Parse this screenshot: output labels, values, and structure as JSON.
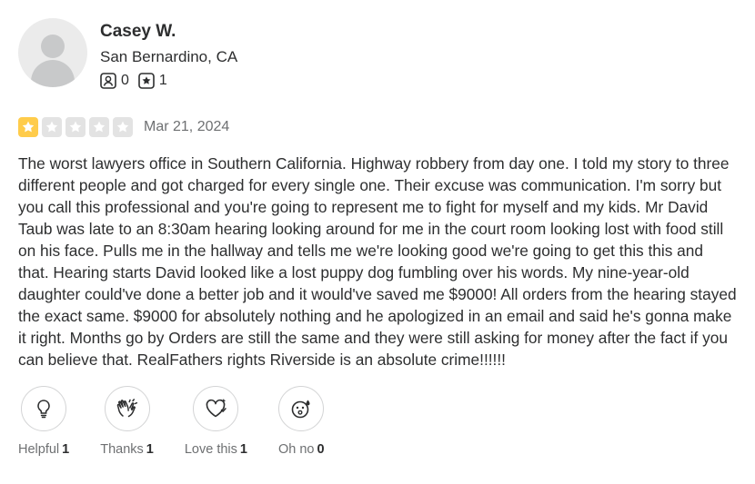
{
  "user": {
    "name": "Casey W.",
    "location": "San Bernardino, CA",
    "friends_count": "0",
    "reviews_count": "1"
  },
  "review": {
    "rating": 1,
    "max_rating": 5,
    "date": "Mar 21, 2024",
    "text": "The worst lawyers office in Southern California. Highway robbery from day one. I told my story to three different people and got charged for every single one. Their excuse was communication. I'm sorry but you call this professional and you're going to represent me to fight for myself and my kids. Mr David Taub was late to an 8:30am hearing looking around for me in the court room looking lost with food still on his face. Pulls me in the hallway and tells me we're looking good we're going to get this this and that. Hearing starts David looked like a lost puppy dog fumbling over his words. My nine-year-old daughter could've done a better job and it would've saved me $9000! All orders from the hearing stayed the exact same. $9000 for absolutely nothing and he apologized in an email and said he's gonna make it right. Months go by Orders are still the same and they were still asking for money after the fact if you can believe that. RealFathers rights Riverside is an absolute crime!!!!!!"
  },
  "reactions": [
    {
      "label": "Helpful",
      "count": "1",
      "icon": "lightbulb-icon"
    },
    {
      "label": "Thanks",
      "count": "1",
      "icon": "clapping-hands-icon"
    },
    {
      "label": "Love this",
      "count": "1",
      "icon": "heart-icon"
    },
    {
      "label": "Oh no",
      "count": "0",
      "icon": "surprised-face-icon"
    }
  ],
  "colors": {
    "star_on": "#ffcc4b",
    "star_off": "#e3e3e3",
    "text": "#2d2e2f",
    "muted": "#6e7072"
  }
}
